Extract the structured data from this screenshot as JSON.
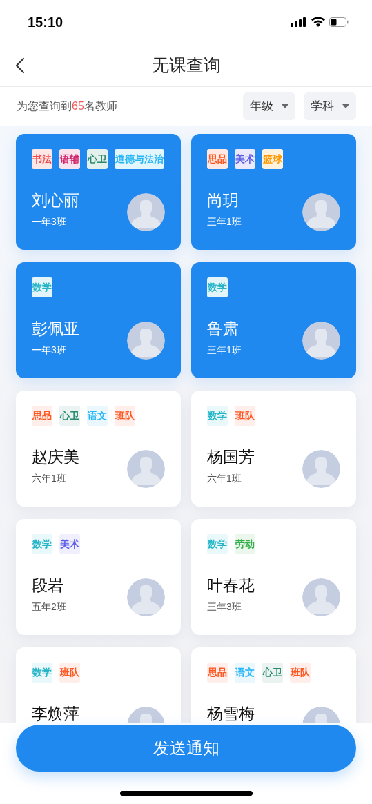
{
  "status_bar": {
    "time": "15:10"
  },
  "header": {
    "title": "无课查询"
  },
  "summary": {
    "text": "为您查询到",
    "count": "65",
    "suffix": "名教师"
  },
  "filters": [
    {
      "label": "年级"
    },
    {
      "label": "学科"
    }
  ],
  "teachers": [
    {
      "name": "刘心丽",
      "class": "一年3班",
      "selected": true,
      "tags": [
        {
          "label": "书法",
          "color": "#f04848"
        },
        {
          "label": "语辅",
          "color": "#d0246c"
        },
        {
          "label": "心卫",
          "color": "#2a8a70"
        },
        {
          "label": "道德与法治",
          "color": "#29b6f6"
        }
      ]
    },
    {
      "name": "尚玥",
      "class": "三年1班",
      "selected": true,
      "tags": [
        {
          "label": "思品",
          "color": "#ff5722"
        },
        {
          "label": "美术",
          "color": "#5c5ce6"
        },
        {
          "label": "篮球",
          "color": "#ff9800"
        }
      ]
    },
    {
      "name": "彭佩亚",
      "class": "一年3班",
      "selected": true,
      "tags": [
        {
          "label": "数学",
          "color": "#26b5c8"
        }
      ]
    },
    {
      "name": "鲁肃",
      "class": "三年1班",
      "selected": true,
      "tags": [
        {
          "label": "数学",
          "color": "#26b5c8"
        }
      ]
    },
    {
      "name": "赵庆美",
      "class": "六年1班",
      "selected": false,
      "tags": [
        {
          "label": "思品",
          "color": "#ff5722"
        },
        {
          "label": "心卫",
          "color": "#2a8a70"
        },
        {
          "label": "语文",
          "color": "#29b6f6"
        },
        {
          "label": "班队",
          "color": "#ff5722"
        }
      ]
    },
    {
      "name": "杨国芳",
      "class": "六年1班",
      "selected": false,
      "tags": [
        {
          "label": "数学",
          "color": "#26b5c8"
        },
        {
          "label": "班队",
          "color": "#ff5722"
        }
      ]
    },
    {
      "name": "段岩",
      "class": "五年2班",
      "selected": false,
      "tags": [
        {
          "label": "数学",
          "color": "#26b5c8"
        },
        {
          "label": "美术",
          "color": "#5c5ce6"
        }
      ]
    },
    {
      "name": "叶春花",
      "class": "三年3班",
      "selected": false,
      "tags": [
        {
          "label": "数学",
          "color": "#26b5c8"
        },
        {
          "label": "劳动",
          "color": "#34b04a"
        }
      ]
    },
    {
      "name": "李焕萍",
      "selected": false,
      "tags": [
        {
          "label": "数学",
          "color": "#26b5c8"
        },
        {
          "label": "班队",
          "color": "#ff5722"
        }
      ]
    },
    {
      "name": "杨雪梅",
      "selected": false,
      "tags": [
        {
          "label": "思品",
          "color": "#ff5722"
        },
        {
          "label": "语文",
          "color": "#29b6f6"
        },
        {
          "label": "心卫",
          "color": "#2a8a70"
        },
        {
          "label": "班队",
          "color": "#ff5722"
        }
      ]
    }
  ],
  "action": {
    "label": "发送通知"
  }
}
